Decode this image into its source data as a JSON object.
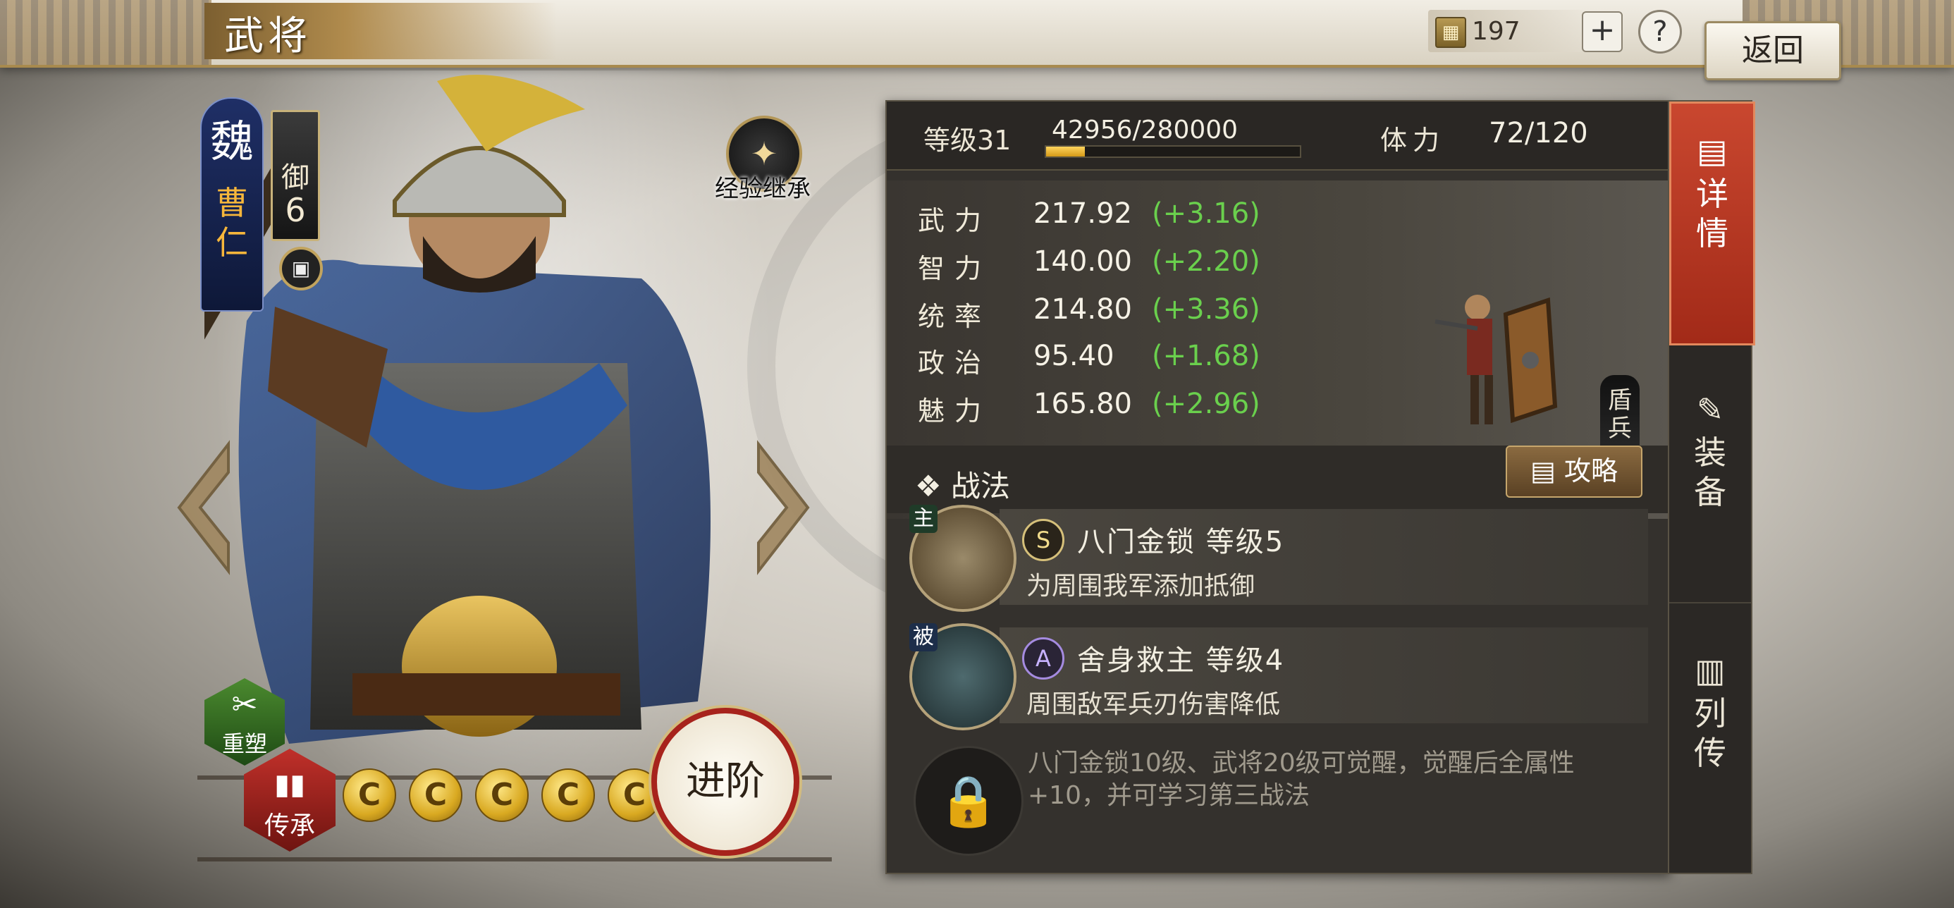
{
  "header": {
    "title": "武将",
    "currency_icon": "jade-token-icon",
    "currency_value": "197",
    "plus_label": "+",
    "help_label": "?",
    "back_label": "返回"
  },
  "hero": {
    "faction": "魏",
    "name": "曹仁",
    "rank_label": "御",
    "rank_value": "6",
    "exp_inherit_label": "经验继承",
    "rebuild_label": "重塑",
    "inherit_label": "传承",
    "advance_label": "进阶",
    "stars": [
      "C",
      "C",
      "C",
      "C",
      "C"
    ]
  },
  "level": {
    "label": "等级31",
    "exp": "42956/280000",
    "exp_fraction": 0.153,
    "stamina_label": "体力",
    "stamina_value": "72/120"
  },
  "stats": [
    {
      "name": "武力",
      "value": "217.92",
      "bonus": "(+3.16)"
    },
    {
      "name": "智力",
      "value": "140.00",
      "bonus": "(+2.20)"
    },
    {
      "name": "统率",
      "value": "214.80",
      "bonus": "(+3.36)"
    },
    {
      "name": "政治",
      "value": "95.40",
      "bonus": "(+1.68)"
    },
    {
      "name": "魅力",
      "value": "165.80",
      "bonus": "(+2.96)"
    }
  ],
  "unit_type": "盾兵",
  "skills": {
    "title": "战法",
    "guide_label": "攻略",
    "items": [
      {
        "tag": "主",
        "grade": "S",
        "name": "八门金锁  等级5",
        "desc": "为周围我军添加抵御"
      },
      {
        "tag": "被",
        "grade": "A",
        "name": "舍身救主  等级4",
        "desc": "周围敌军兵刃伤害降低"
      }
    ],
    "locked_text": "八门金锁10级、武将20级可觉醒，觉醒后全属性+10，并可学习第三战法"
  },
  "tabs": [
    {
      "label": "详情",
      "icon": "detail-icon"
    },
    {
      "label": "装备",
      "icon": "equipment-icon"
    },
    {
      "label": "列传",
      "icon": "biography-icon"
    }
  ],
  "colors": {
    "accent": "#c9472f",
    "bonus": "#6ad04d",
    "faction": "#1f2f66",
    "name": "#f6b63b"
  }
}
